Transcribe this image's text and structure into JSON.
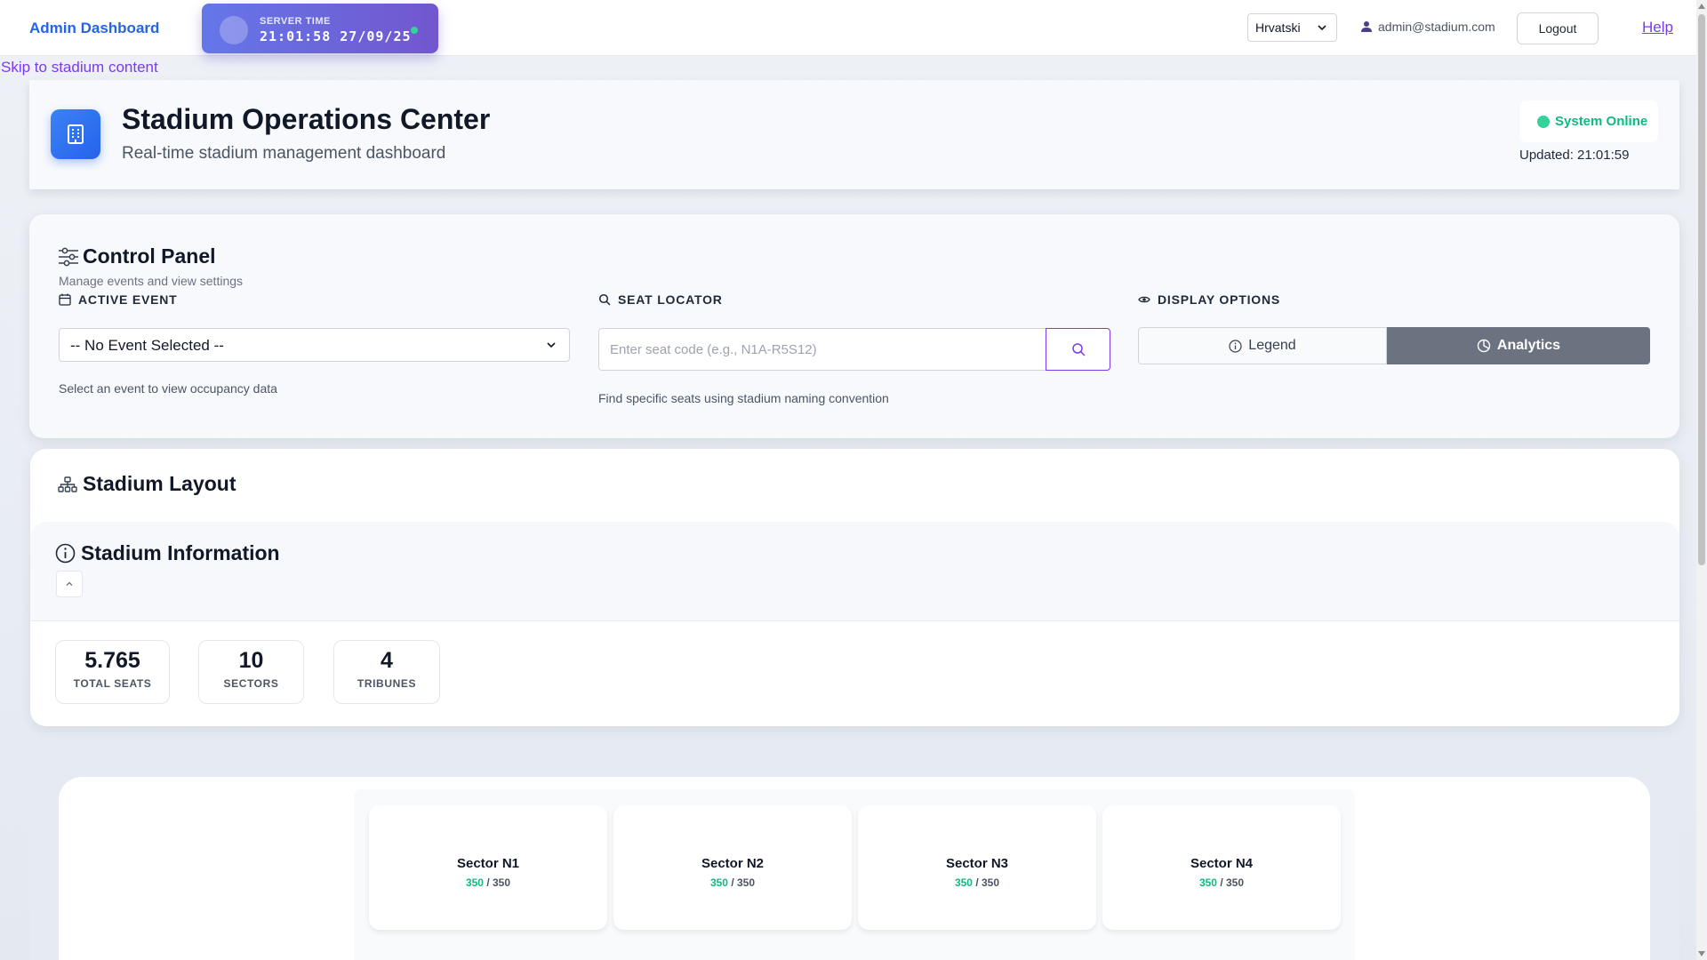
{
  "nav": {
    "brand": "Admin Dashboard",
    "server_time_label": "SERVER TIME",
    "server_time_value": "21:01:58 27/09/25",
    "language": "Hrvatski",
    "user_email": "admin@stadium.com",
    "logout_label": "Logout",
    "help_label": "Help"
  },
  "skip_link": "Skip to stadium content",
  "header": {
    "title": "Stadium Operations Center",
    "subtitle": "Real-time stadium management dashboard",
    "status": "System Online",
    "updated": "Updated: 21:01:59"
  },
  "control_panel": {
    "title": "Control Panel",
    "subtitle": "Manage events and view settings",
    "active_event_label": "ACTIVE EVENT",
    "event_value": "-- No Event Selected --",
    "event_help": "Select an event to view occupancy data",
    "seat_locator_label": "SEAT LOCATOR",
    "seat_placeholder": "Enter seat code (e.g., N1A-R5S12)",
    "seat_help": "Find specific seats using stadium naming convention",
    "display_options_label": "DISPLAY OPTIONS",
    "legend_label": "Legend",
    "analytics_label": "Analytics"
  },
  "layout": {
    "title": "Stadium Layout",
    "info_title": "Stadium Information",
    "stats": [
      {
        "value": "5.765",
        "caption": "TOTAL SEATS"
      },
      {
        "value": "10",
        "caption": "SECTORS"
      },
      {
        "value": "4",
        "caption": "TRIBUNES"
      }
    ]
  },
  "sectors": [
    {
      "name": "Sector N1",
      "available": "350",
      "sep": " / ",
      "total": "350"
    },
    {
      "name": "Sector N2",
      "available": "350",
      "sep": " / ",
      "total": "350"
    },
    {
      "name": "Sector N3",
      "available": "350",
      "sep": " / ",
      "total": "350"
    },
    {
      "name": "Sector N4",
      "available": "350",
      "sep": " / ",
      "total": "350"
    }
  ],
  "colors": {
    "brand": "#2563eb",
    "accent_purple": "#7c3aed",
    "online": "#10b981",
    "analytics_active": "#6b7280"
  }
}
